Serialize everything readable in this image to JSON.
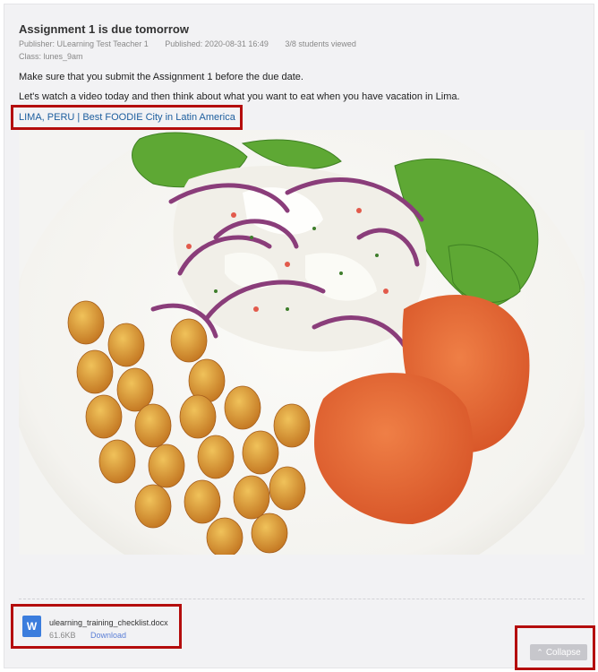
{
  "announcement": {
    "title": "Assignment 1 is due tomorrow",
    "publisher": "Publisher: ULearning Test Teacher 1",
    "published": "Published: 2020-08-31 16:49",
    "views": "3/8 students viewed",
    "class": "Class: lunes_9am",
    "body_line_1": "Make sure that you submit the Assignment 1 before the due date.",
    "body_line_2": "Let's watch a video today and then think about what you want to eat when you have vacation in Lima.",
    "link_text": "LIMA, PERU | Best FOODIE City in Latin America"
  },
  "image": {
    "icon": "ceviche-food-photo"
  },
  "attachment": {
    "file_icon_letter": "W",
    "file_name": "ulearning_training_checklist.docx",
    "file_size": "61.6KB",
    "download_label": "Download",
    "icon_color": "#3b7ddd"
  },
  "collapse": {
    "label": "Collapse",
    "icon": "chevron-up-icon"
  },
  "colors": {
    "highlight": "#b40d0d",
    "link": "#1d5e9e",
    "download": "#5b7fd6"
  }
}
